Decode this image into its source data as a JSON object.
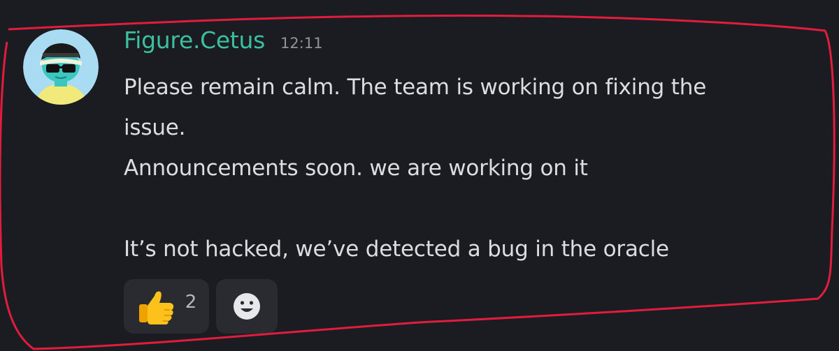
{
  "message": {
    "username": "Figure.Cetus",
    "timestamp": "12:11",
    "lines": [
      "Please remain calm. The team is working on fixing the",
      "issue.",
      "Announcements soon. we are working on it",
      "",
      "It’s not hacked, we’ve detected a bug in the oracle"
    ],
    "avatar_icon": "cartoon-character-avatar"
  },
  "reactions": [
    {
      "emoji": "thumbs-up-icon",
      "count": "2"
    },
    {
      "emoji": "add-reaction-smiley-icon"
    }
  ],
  "colors": {
    "background": "#1b1c21",
    "username": "#3bc0a0",
    "timestamp": "#8f939b",
    "text": "#dcdde1",
    "reaction_bg": "#2a2b31",
    "annotation": "#e21c3c"
  }
}
